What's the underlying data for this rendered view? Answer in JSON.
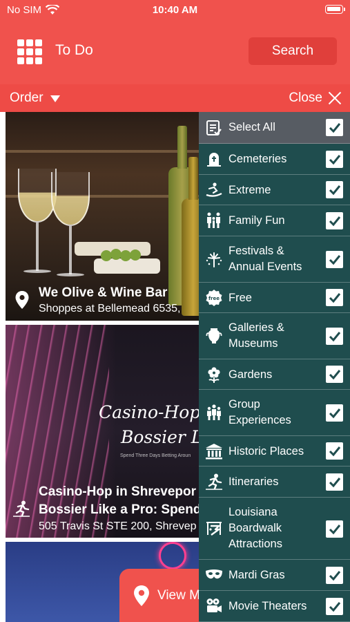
{
  "status_bar": {
    "carrier": "No SIM",
    "time": "10:40 AM"
  },
  "nav": {
    "title": "To Do",
    "search_label": "Search"
  },
  "filter_bar": {
    "order_label": "Order",
    "close_label": "Close"
  },
  "cards": [
    {
      "title": "We Olive & Wine Bar",
      "subtitle": "Shoppes at Bellemead 6535,",
      "icon": "map-pin-icon"
    },
    {
      "title": "Casino-Hop in Shrevepor",
      "title_line2": "Bossier Like a Pro: Spend",
      "subtitle": "505 Travis St STE 200, Shrevep",
      "icon": "trail-icon",
      "image_text": {
        "line1": "Casino-Hop in S",
        "line2": "Bossier Like",
        "tagline": "Spend Three Days Betting Aroun"
      }
    },
    {
      "title": "",
      "subtitle": ""
    }
  ],
  "view_map": {
    "label": "View M",
    "icon": "map-pin-icon"
  },
  "panel": {
    "items": [
      {
        "label": "Select All",
        "icon": "list-check-icon",
        "checked": true
      },
      {
        "label": "Cemeteries",
        "icon": "tombstone-icon",
        "checked": true
      },
      {
        "label": "Extreme",
        "icon": "snowboarder-icon",
        "checked": true
      },
      {
        "label": "Family Fun",
        "icon": "family-icon",
        "checked": true
      },
      {
        "label": "Festivals & Annual Events",
        "icon": "fireworks-icon",
        "checked": true
      },
      {
        "label": "Free",
        "icon": "free-badge-icon",
        "checked": true
      },
      {
        "label": "Galleries & Museums",
        "icon": "vase-icon",
        "checked": true
      },
      {
        "label": "Gardens",
        "icon": "flower-icon",
        "checked": true
      },
      {
        "label": "Group Experiences",
        "icon": "group-icon",
        "checked": true
      },
      {
        "label": "Historic Places",
        "icon": "columns-icon",
        "checked": true
      },
      {
        "label": "Itineraries",
        "icon": "hiker-icon",
        "checked": true
      },
      {
        "label": "Louisiana Boardwalk Attractions",
        "icon": "boardwalk-icon",
        "checked": true
      },
      {
        "label": "Mardi Gras",
        "icon": "mask-icon",
        "checked": true
      },
      {
        "label": "Movie Theaters",
        "icon": "film-camera-icon",
        "checked": true
      }
    ]
  },
  "colors": {
    "primary": "#f0524d",
    "panel": "#1f4d4e",
    "select_all_bg": "#575c63",
    "button_dark": "#e03f3b"
  }
}
